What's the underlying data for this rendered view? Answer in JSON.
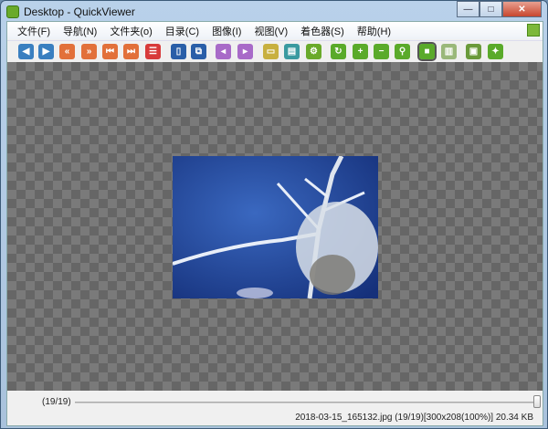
{
  "window": {
    "title": "Desktop - QuickViewer",
    "minimize": "—",
    "maximize": "□",
    "close": "✕"
  },
  "menu": [
    "文件(F)",
    "导航(N)",
    "文件夹(o)",
    "目录(C)",
    "图像(I)",
    "视图(V)",
    "着色器(S)",
    "帮助(H)"
  ],
  "toolbar": [
    {
      "name": "prev-icon",
      "color": "#3a7fc0",
      "glyph": "◀"
    },
    {
      "name": "next-icon",
      "color": "#3a7fc0",
      "glyph": "▶"
    },
    {
      "name": "rewind-icon",
      "color": "#e2703a",
      "glyph": "«"
    },
    {
      "name": "fast-forward-icon",
      "color": "#e2703a",
      "glyph": "»"
    },
    {
      "name": "first-icon",
      "color": "#e2703a",
      "glyph": "⏮"
    },
    {
      "name": "last-icon",
      "color": "#e2703a",
      "glyph": "⏭"
    },
    {
      "name": "list-icon",
      "color": "#d83a3a",
      "glyph": "☰"
    },
    {
      "name": "open-file-icon",
      "color": "#2a5ea8",
      "glyph": "▯"
    },
    {
      "name": "copy-icon",
      "color": "#2a5ea8",
      "glyph": "⧉"
    },
    {
      "name": "page-prev-icon",
      "color": "#a86ac8",
      "glyph": "◂"
    },
    {
      "name": "page-next-icon",
      "color": "#a86ac8",
      "glyph": "▸"
    },
    {
      "name": "folder-icon",
      "color": "#c8b040",
      "glyph": "▭"
    },
    {
      "name": "catalog-icon",
      "color": "#3a9aa0",
      "glyph": "▤"
    },
    {
      "name": "settings-icon",
      "color": "#6aaa2a",
      "glyph": "⚙"
    },
    {
      "name": "rotate-icon",
      "color": "#5aaa2a",
      "glyph": "↻"
    },
    {
      "name": "zoom-in-icon",
      "color": "#5aaa2a",
      "glyph": "+"
    },
    {
      "name": "zoom-out-icon",
      "color": "#5aaa2a",
      "glyph": "−"
    },
    {
      "name": "magnify-icon",
      "color": "#5aaa2a",
      "glyph": "⚲"
    },
    {
      "name": "single-page-icon",
      "color": "#5aaa2a",
      "glyph": "■"
    },
    {
      "name": "dual-page-icon",
      "color": "#9ab87a",
      "glyph": "▥"
    },
    {
      "name": "slideshow-icon",
      "color": "#6a9a3a",
      "glyph": "▣"
    },
    {
      "name": "pin-icon",
      "color": "#5aaa2a",
      "glyph": "✦"
    }
  ],
  "status": {
    "position": "(19/19)",
    "progress": 1.0,
    "info": "2018-03-15_165132.jpg (19/19)[300x208(100%)] 20.34 KB"
  }
}
